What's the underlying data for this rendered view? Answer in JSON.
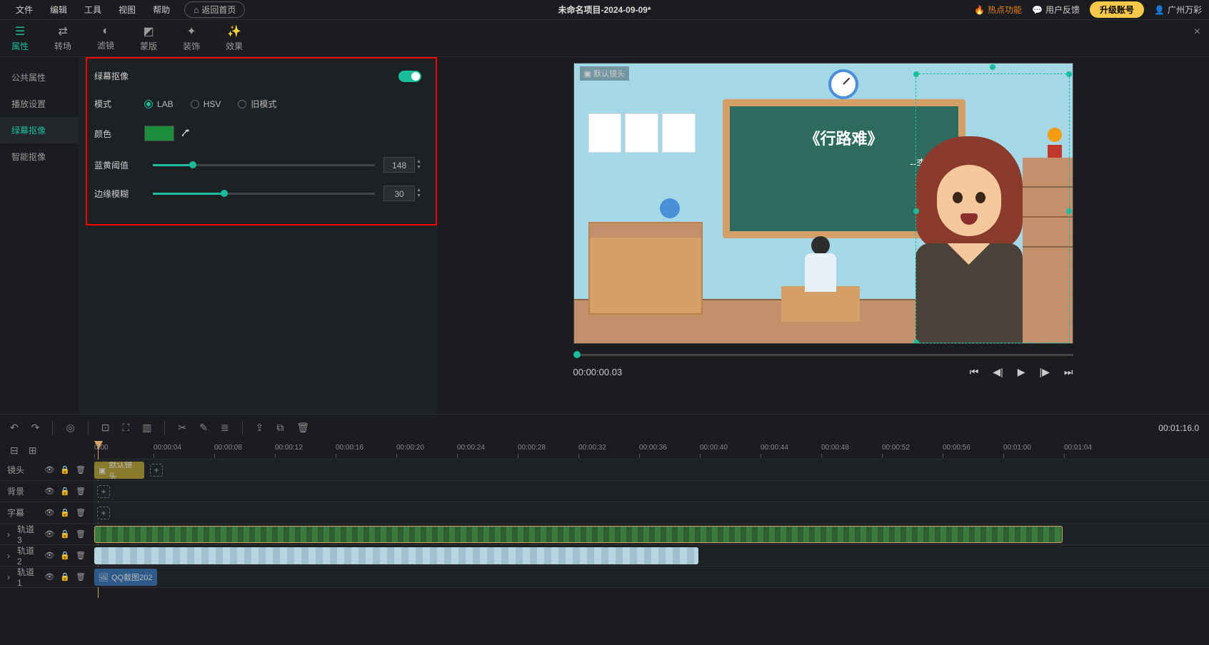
{
  "menubar": {
    "file": "文件",
    "edit": "编辑",
    "tools": "工具",
    "view": "视图",
    "help": "帮助",
    "return_home": "返回首页",
    "project_title": "未命名项目-2024-09-09*",
    "hot_feature": "热点功能",
    "user_feedback": "用户反馈",
    "upgrade": "升级账号",
    "user": "广州万彩"
  },
  "tool_tabs": {
    "attributes": "属性",
    "transition": "转场",
    "filter": "滤镜",
    "mask": "蒙版",
    "decoration": "装饰",
    "effect": "效果"
  },
  "prop_sidebar": {
    "common": "公共属性",
    "playback": "播放设置",
    "greenscreen": "绿幕抠像",
    "smart": "智能抠像"
  },
  "greenscreen": {
    "title": "绿幕抠像",
    "mode_label": "模式",
    "mode_lab": "LAB",
    "mode_hsv": "HSV",
    "mode_old": "旧模式",
    "color_label": "颜色",
    "color_value": "#1a8c3a",
    "threshold_label": "蓝黄阈值",
    "threshold_value": "148",
    "blur_label": "边缘模糊",
    "blur_value": "30"
  },
  "preview": {
    "cam_label": "默认镜头",
    "chalk_title": "《行路难》",
    "chalk_author": "--李白"
  },
  "playback": {
    "timecode": "00:00:00.03"
  },
  "timeline": {
    "duration": "00:01:16.0",
    "ticks": [
      "0:00",
      "00:00:04",
      "00:00:08",
      "00:00:12",
      "00:00:16",
      "00:00:20",
      "00:00:24",
      "00:00:28",
      "00:00:32",
      "00:00:36",
      "00:00:40",
      "00:00:44",
      "00:00:48",
      "00:00:52",
      "00:00:56",
      "00:01:00",
      "00:01:04"
    ],
    "tracks": {
      "shot": "镜头",
      "bg": "背景",
      "subtitle": "字幕",
      "track3": "轨道3",
      "track2": "轨道2",
      "track1": "轨道1"
    },
    "clips": {
      "default_shot": "默认镜头",
      "qq_screenshot": "QQ截图202"
    }
  }
}
